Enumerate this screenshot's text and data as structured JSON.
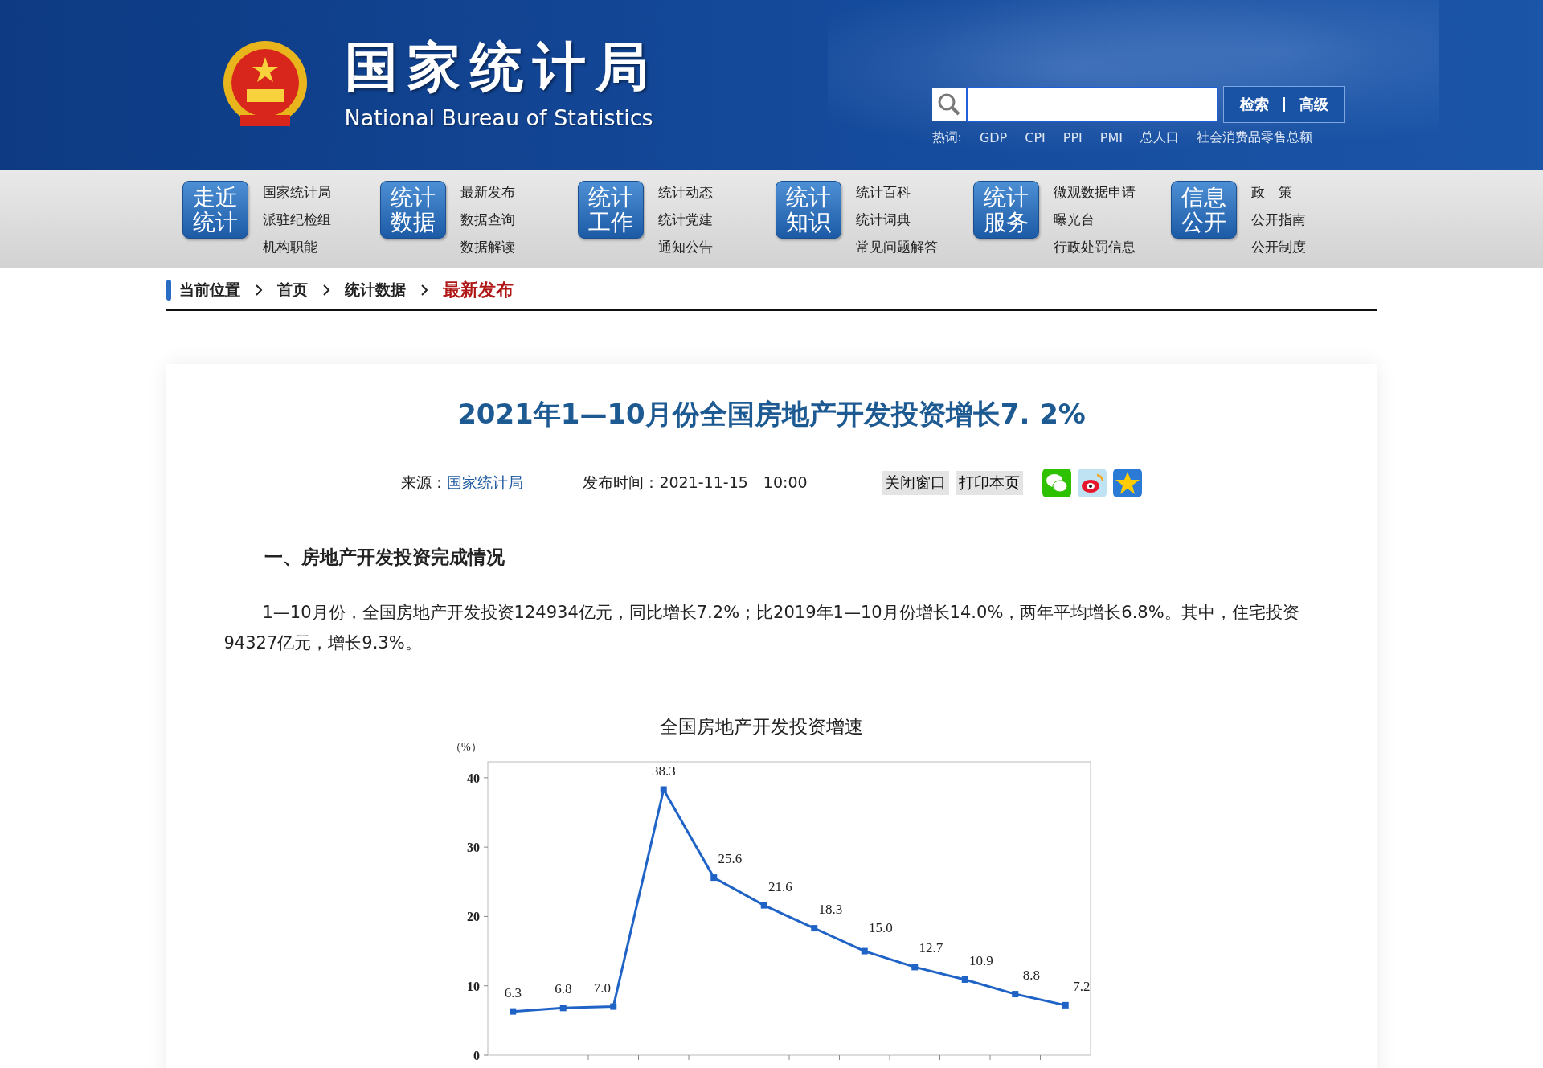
{
  "header": {
    "title": "国家统计局",
    "subtitle": "National Bureau of Statistics",
    "search": {
      "buttons": [
        "检索",
        "高级"
      ]
    },
    "hot_label": "热词:",
    "hot_words": [
      "GDP",
      "CPI",
      "PPI",
      "PMI",
      "总人口",
      "社会消费品零售总额"
    ]
  },
  "nav": [
    {
      "label": "走近统计",
      "links": [
        "国家统计局",
        "派驻纪检组",
        "机构职能"
      ]
    },
    {
      "label": "统计数据",
      "links": [
        "最新发布",
        "数据查询",
        "数据解读"
      ]
    },
    {
      "label": "统计工作",
      "links": [
        "统计动态",
        "统计党建",
        "通知公告"
      ]
    },
    {
      "label": "统计知识",
      "links": [
        "统计百科",
        "统计词典",
        "常见问题解答"
      ]
    },
    {
      "label": "统计服务",
      "links": [
        "微观数据申请",
        "曝光台",
        "行政处罚信息"
      ]
    },
    {
      "label": "信息公开",
      "links": [
        "政　策",
        "公开指南",
        "公开制度"
      ]
    }
  ],
  "breadcrumb": {
    "label": "当前位置",
    "items": [
      {
        "text": "首页",
        "selected": false
      },
      {
        "text": "统计数据",
        "selected": false
      },
      {
        "text": "最新发布",
        "selected": true
      }
    ]
  },
  "article": {
    "title": "2021年1—10月份全国房地产开发投资增长7. 2%",
    "source_label": "来源：",
    "source": "国家统计局",
    "time": "发布时间：2021-11-15　10:00",
    "actions": [
      "关闭窗口",
      "打印本页"
    ],
    "section_heading": "一、房地产开发投资完成情况",
    "paragraph": "1—10月份，全国房地产开发投资124934亿元，同比增长7.2%；比2019年1—10月份增长14.0%，两年平均增长6.8%。其中，住宅投资94327亿元，增长9.3%。",
    "chart_data": {
      "type": "line",
      "title": "全国房地产开发投资增速",
      "ylabel": "（%）",
      "ylim": [
        0,
        42.3
      ],
      "yticks": [
        0,
        10,
        20,
        30,
        40
      ],
      "value_labels": [
        "6.3",
        "6.8",
        "7.0",
        "38.3",
        "25.6",
        "21.6",
        "18.3",
        "15.0",
        "12.7",
        "10.9",
        "8.8",
        "7.2"
      ],
      "series": [
        {
          "color": "#1f63c6",
          "marker": "square",
          "values": [
            6.3,
            6.8,
            7.0,
            38.3,
            25.6,
            21.6,
            18.3,
            15.0,
            12.7,
            10.9,
            8.8,
            7.2
          ]
        }
      ]
    }
  }
}
